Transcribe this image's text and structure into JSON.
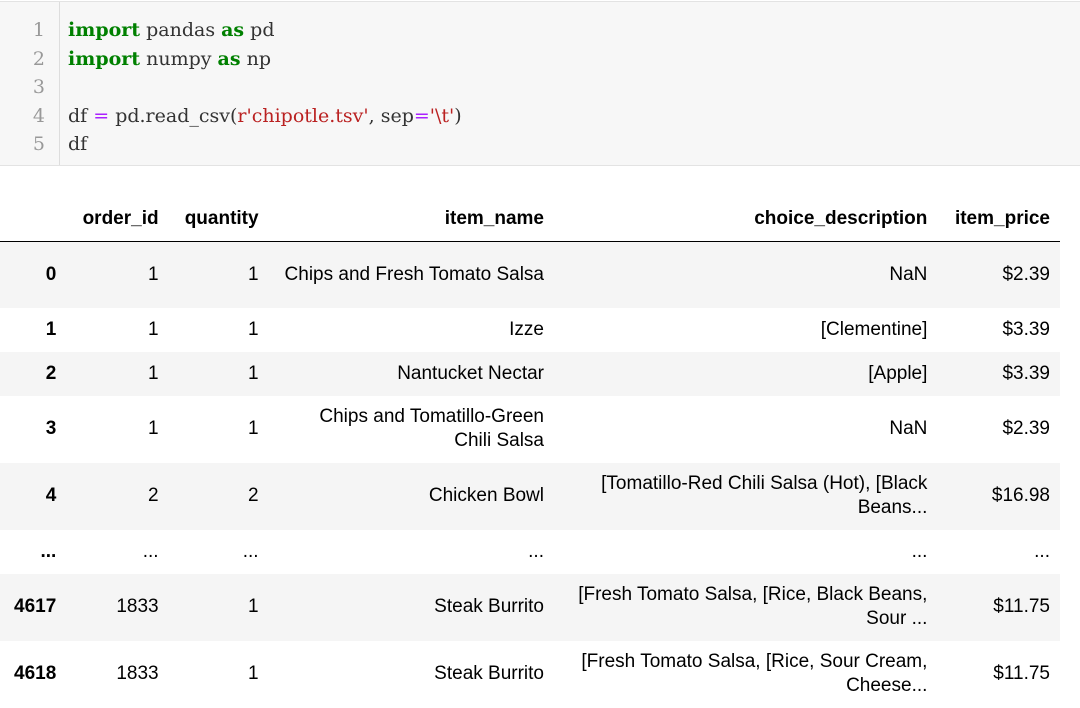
{
  "code_cell": {
    "lines": [
      {
        "n": "1",
        "tokens": [
          {
            "t": "import",
            "c": "kw"
          },
          {
            "t": " pandas ",
            "c": ""
          },
          {
            "t": "as",
            "c": "kw"
          },
          {
            "t": " pd",
            "c": ""
          }
        ]
      },
      {
        "n": "2",
        "tokens": [
          {
            "t": "import",
            "c": "kw"
          },
          {
            "t": " numpy ",
            "c": ""
          },
          {
            "t": "as",
            "c": "kw"
          },
          {
            "t": " np",
            "c": ""
          }
        ]
      },
      {
        "n": "3",
        "tokens": []
      },
      {
        "n": "4",
        "tokens": [
          {
            "t": "df ",
            "c": ""
          },
          {
            "t": "=",
            "c": "op"
          },
          {
            "t": " pd.read_csv(",
            "c": ""
          },
          {
            "t": "r'chipotle.tsv'",
            "c": "str"
          },
          {
            "t": ", sep",
            "c": ""
          },
          {
            "t": "=",
            "c": "op"
          },
          {
            "t": "'\\t'",
            "c": "str"
          },
          {
            "t": ")",
            "c": ""
          }
        ]
      },
      {
        "n": "5",
        "tokens": [
          {
            "t": "df",
            "c": ""
          }
        ]
      }
    ]
  },
  "dataframe": {
    "columns": [
      "",
      "order_id",
      "quantity",
      "item_name",
      "choice_description",
      "item_price"
    ],
    "rows": [
      {
        "index": "0",
        "cells": [
          "1",
          "1",
          "Chips and Fresh Tomato Salsa",
          "NaN",
          "$2.39"
        ],
        "height": 66
      },
      {
        "index": "1",
        "cells": [
          "1",
          "1",
          "Izze",
          "[Clementine]",
          "$3.39"
        ],
        "height": 44
      },
      {
        "index": "2",
        "cells": [
          "1",
          "1",
          "Nantucket Nectar",
          "[Apple]",
          "$3.39"
        ],
        "height": 44
      },
      {
        "index": "3",
        "cells": [
          "1",
          "1",
          "Chips and Tomatillo-Green Chili Salsa",
          "NaN",
          "$2.39"
        ],
        "height": 67
      },
      {
        "index": "4",
        "cells": [
          "2",
          "2",
          "Chicken Bowl",
          "[Tomatillo-Red Chili Salsa (Hot), [Black Beans...",
          "$16.98"
        ],
        "height": 67
      },
      {
        "index": "...",
        "cells": [
          "...",
          "...",
          "...",
          "...",
          "..."
        ],
        "height": 44
      },
      {
        "index": "4617",
        "cells": [
          "1833",
          "1",
          "Steak Burrito",
          "[Fresh Tomato Salsa, [Rice, Black Beans, Sour ...",
          "$11.75"
        ],
        "height": 67
      },
      {
        "index": "4618",
        "cells": [
          "1833",
          "1",
          "Steak Burrito",
          "[Fresh Tomato Salsa, [Rice, Sour Cream, Cheese...",
          "$11.75"
        ],
        "height": 67
      }
    ]
  }
}
